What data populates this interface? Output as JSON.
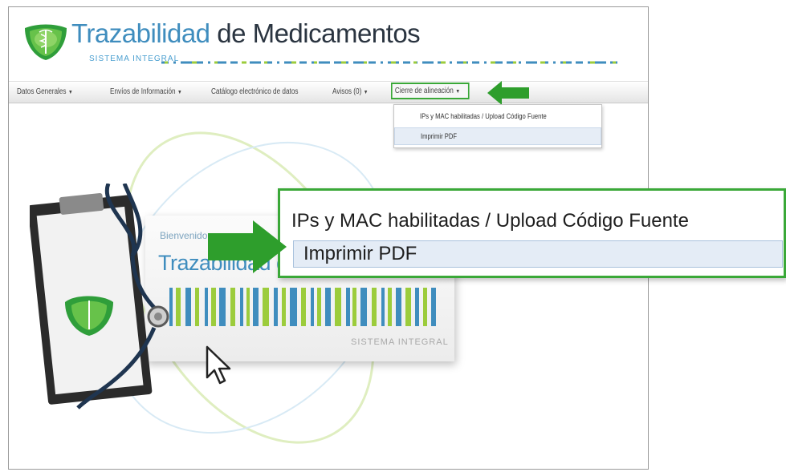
{
  "brand": {
    "title_part1": "Trazabilidad",
    "title_part2": " de Medicamentos",
    "subtitle": "SISTEMA INTEGRAL"
  },
  "nav": {
    "items": [
      {
        "label": "Datos Generales"
      },
      {
        "label": "Envíos de Información"
      },
      {
        "label": "Catálogo electrónico de datos"
      },
      {
        "label": "Avisos (0)"
      },
      {
        "label": "Cierre de alineación"
      }
    ]
  },
  "dropdown": {
    "items": [
      {
        "label": "IPs y MAC habilitadas / Upload Código Fuente"
      },
      {
        "label": "Imprimir PDF"
      }
    ]
  },
  "welcome": {
    "label": "Bienvenido",
    "title": "Trazabilidad de Medicamentos",
    "subtitle": "SISTEMA INTEGRAL"
  },
  "zoom": {
    "items": [
      {
        "label": "IPs y MAC habilitadas / Upload Código Fuente"
      },
      {
        "label": "Imprimir PDF"
      }
    ]
  },
  "colors": {
    "accent_green": "#3aa838",
    "brand_blue": "#3f8dbe",
    "highlight": "#e4ecf6"
  }
}
